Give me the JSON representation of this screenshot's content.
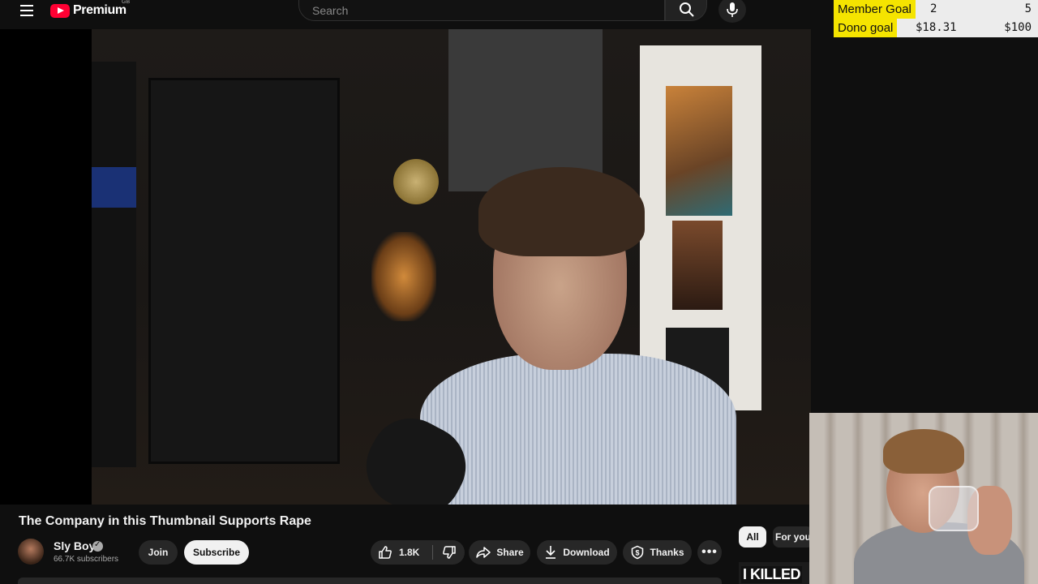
{
  "header": {
    "logo_text": "Premium",
    "region": "GB",
    "search_placeholder": "Search"
  },
  "overlay": {
    "member_goal": {
      "label": "Member Goal",
      "current": "2",
      "target": "5"
    },
    "dono_goal": {
      "label": "Dono goal",
      "current": "$18.31",
      "target": "$100"
    }
  },
  "video": {
    "title": "The Company in this Thumbnail Supports Rape"
  },
  "channel": {
    "name": "Sly Boy",
    "subscribers": "66.7K subscribers",
    "join_label": "Join",
    "subscribe_label": "Subscribe"
  },
  "actions": {
    "like_count": "1.8K",
    "share_label": "Share",
    "download_label": "Download",
    "thanks_label": "Thanks",
    "more_label": "•••"
  },
  "sidebar": {
    "chips": [
      "All",
      "For you"
    ],
    "recommended_thumb_text": "I KILLED"
  },
  "colors": {
    "background": "#0f0f0f",
    "brand_red": "#ff0033",
    "goal_highlight": "#f5e400",
    "button_bg": "#272727",
    "subscribe_bg": "#f1f1f1"
  }
}
